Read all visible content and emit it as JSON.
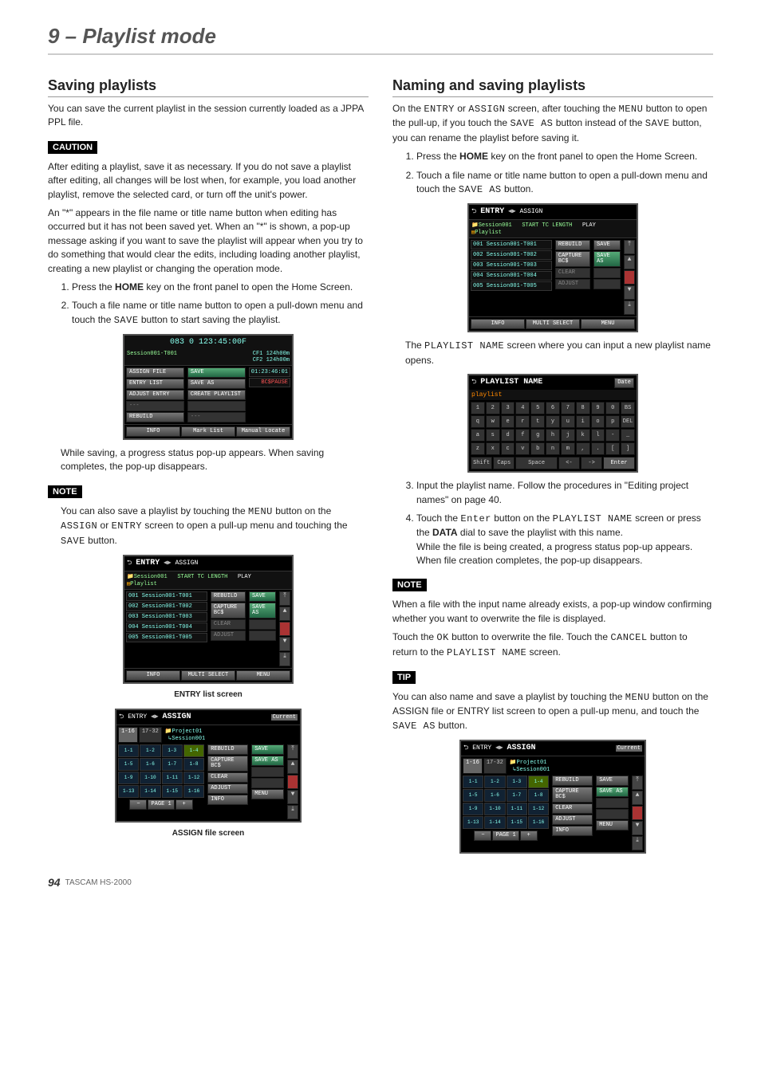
{
  "chapter_title": "9 – Playlist mode",
  "left": {
    "heading": "Saving playlists",
    "intro": "You can save the current playlist in the session currently loaded as a JPPA PPL file.",
    "caution_label": "CAUTION",
    "caution_p1": "After editing a playlist, save it as necessary. If you do not save a playlist after editing, all changes will be lost when, for example, you load another playlist, remove the selected card, or turn off the unit's power.",
    "caution_p2": "An \"*\" appears in the file name or title name button when editing has occurred but it has not been saved yet. When an \"*\" is shown, a pop-up message asking if you want to save the playlist will appear when you try to do something that would clear the edits, including loading another playlist, creating a new playlist or changing the operation mode.",
    "step1a": "Press the ",
    "step1_key": "HOME",
    "step1b": " key on the front panel to open the Home Screen.",
    "step2a": "Touch a file name or title name button to open a pull-down menu and touch the ",
    "step2_btn": "SAVE",
    "step2b": " button to start saving the playlist.",
    "after1": "While saving, a progress status pop-up appears. When saving completes, the pop-up disappears.",
    "note_label": "NOTE",
    "note_a": "You can also save a playlist by touching the ",
    "note_menu": "MENU",
    "note_b": " button on the ",
    "note_assign": "ASSIGN",
    "note_c": " or ",
    "note_entry": "ENTRY",
    "note_d": " screen to open a pull-up menu and touching the ",
    "note_save": "SAVE",
    "note_e": " button.",
    "fig1_caption": "ENTRY list screen",
    "fig2_caption": "ASSIGN file screen",
    "home_screen": {
      "time": "083 0 123:45:00F",
      "title": "Session001-T001",
      "cf1": "CF1 124h00m",
      "cf2": "CF2 124h00m",
      "side": [
        "ASSIGN FILE",
        "ENTRY LIST",
        "ADJUST ENTRY",
        "---",
        "REBUILD"
      ],
      "side2": [
        "SAVE",
        "SAVE AS",
        "CREATE PLAYLIST",
        "",
        "---"
      ],
      "tc": "01:23:46:01",
      "status": "BC$PAUSE",
      "footer": [
        "INFO",
        "Mark List",
        "Manual Locate"
      ]
    },
    "entry_screen": {
      "hdr_left": "ENTRY",
      "hdr_right": "ASSIGN",
      "sub1": "Session001",
      "sub2": "Playlist",
      "col_len": "START TC LENGTH",
      "col_play": "PLAY",
      "rows": [
        "001 Session001-T001",
        "002 Session001-T002",
        "003 Session001-T003",
        "004 Session001-T004",
        "005 Session001-T005"
      ],
      "btns_l": [
        "REBUILD",
        "CAPTURE BC$",
        "CLEAR",
        "ADJUST"
      ],
      "btns_r": [
        "SAVE",
        "SAVE AS",
        "",
        ""
      ],
      "footer_l": "INFO",
      "footer_m": "MULTI SELECT",
      "footer_r": "MENU"
    },
    "assign_screen": {
      "hdr_left": "ENTRY",
      "hdr_right": "ASSIGN",
      "current": "Current",
      "tab1": "1-16",
      "tab2": "17-32",
      "proj": "Project01",
      "sess": "Session001",
      "cells": [
        "1-1",
        "1-2",
        "1-3",
        "1-4",
        "1-5",
        "1-6",
        "1-7",
        "1-8",
        "1-9",
        "1-10",
        "1-11",
        "1-12",
        "1-13",
        "1-14",
        "1-15",
        "1-16"
      ],
      "btns_l": [
        "REBUILD",
        "CAPTURE BC$",
        "CLEAR",
        "ADJUST"
      ],
      "btns_r": [
        "SAVE",
        "SAVE AS",
        "",
        ""
      ],
      "page": "PAGE 1",
      "footer_l": "INFO",
      "footer_r": "MENU"
    }
  },
  "right": {
    "heading": "Naming and saving playlists",
    "intro_a": "On the ",
    "intro_entry": "ENTRY",
    "intro_b": " or ",
    "intro_assign": "ASSIGN",
    "intro_c": " screen, after touching the ",
    "intro_menu": "MENU",
    "intro_d": " button to open the pull-up, if you touch the ",
    "intro_saveas": "SAVE AS",
    "intro_e": " button instead of the ",
    "intro_save": "SAVE",
    "intro_f": " button, you can rename the playlist before saving it.",
    "step1a": "Press the ",
    "step1_key": "HOME",
    "step1b": " key on the front panel to open the Home Screen.",
    "step2a": "Touch a file name or title name button to open a pull-down menu and touch the ",
    "step2_btn": "SAVE AS",
    "step2b": " button.",
    "mid_a": "The ",
    "mid_name": "PLAYLIST NAME",
    "mid_b": " screen where you can input a new playlist name opens.",
    "step3": "Input the playlist name. Follow the procedures in \"Editing project names\" on page 40.",
    "step4a": "Touch the ",
    "step4_enter": "Enter",
    "step4b": " button on the ",
    "step4_name": "PLAYLIST NAME",
    "step4c": " screen or press the ",
    "step4_data": "DATA",
    "step4d": " dial to save the playlist with this name.",
    "step4e": "While the file is being created, a progress status pop-up appears.",
    "step4f": "When file creation completes, the pop-up disappears.",
    "note_label": "NOTE",
    "note_p1": "When a file with the input name already exists, a pop-up window confirming whether you want to overwrite the file is displayed.",
    "note_p2a": "Touch the ",
    "note_ok": "OK",
    "note_p2b": " button to overwrite the file. Touch the ",
    "note_cancel": "CANCEL",
    "note_p2c": " button to return to the ",
    "note_name": "PLAYLIST NAME",
    "note_p2d": " screen.",
    "tip_label": "TIP",
    "tip_a": "You can also name and save a playlist by touching the ",
    "tip_menu": "MENU",
    "tip_b": " button on the ASSIGN file or ENTRY list screen to open a pull-up menu, and touch the ",
    "tip_saveas": "SAVE AS",
    "tip_c": " button.",
    "kbd": {
      "title": "PLAYLIST NAME",
      "date": "Date",
      "input": "playlist",
      "rows": [
        [
          "1",
          "2",
          "3",
          "4",
          "5",
          "6",
          "7",
          "8",
          "9",
          "0",
          "BS"
        ],
        [
          "q",
          "w",
          "e",
          "r",
          "t",
          "y",
          "u",
          "i",
          "o",
          "p",
          "DEL"
        ],
        [
          "a",
          "s",
          "d",
          "f",
          "g",
          "h",
          "j",
          "k",
          "l",
          "-",
          "_"
        ],
        [
          "z",
          "x",
          "c",
          "v",
          "b",
          "n",
          "m",
          ",",
          ".",
          "[",
          "]"
        ]
      ],
      "bottom": [
        "Shift",
        "Caps",
        "Space",
        "<-",
        "->",
        "Enter"
      ]
    }
  },
  "footer": {
    "page_num": "94",
    "model": "TASCAM HS-2000"
  }
}
